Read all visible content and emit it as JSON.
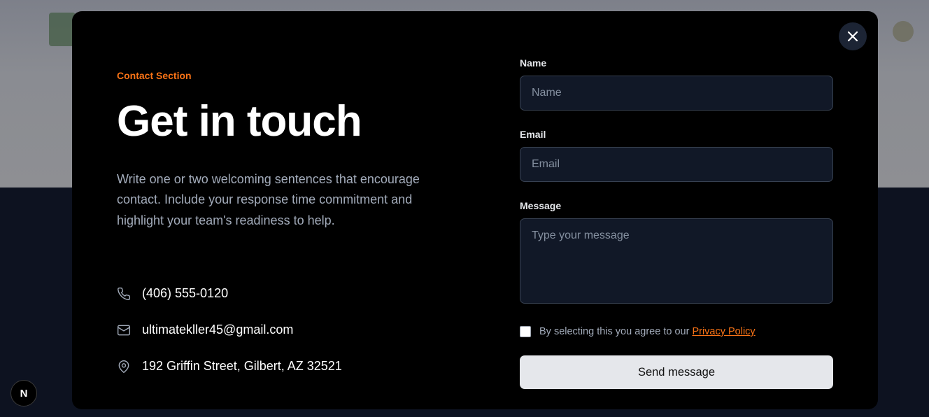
{
  "background": {
    "top_color": "#8a8c92",
    "bottom_color": "#0d1220"
  },
  "modal": {
    "close_icon": "close-icon",
    "eyebrow": "Contact Section",
    "title": "Get in touch",
    "description": "Write one or two welcoming sentences that encourage contact. Include your response time commitment and highlight your team's readiness to help.",
    "contacts": [
      {
        "icon": "phone-icon",
        "text": "(406) 555-0120"
      },
      {
        "icon": "mail-icon",
        "text": "ultimatekller45@gmail.com"
      },
      {
        "icon": "location-pin-icon",
        "text": "192 Griffin Street, Gilbert, AZ 32521"
      }
    ]
  },
  "form": {
    "name": {
      "label": "Name",
      "placeholder": "Name",
      "value": ""
    },
    "email": {
      "label": "Email",
      "placeholder": "Email",
      "value": ""
    },
    "message": {
      "label": "Message",
      "placeholder": "Type your message",
      "value": ""
    },
    "agree_text": "By selecting this you agree to our ",
    "policy_link": "Privacy Policy",
    "agree_checked": false,
    "submit_label": "Send message"
  },
  "next_badge": "N",
  "colors": {
    "accent": "#f97316",
    "modal_bg": "#000000",
    "input_bg": "#111827",
    "button_bg": "#e5e7eb"
  }
}
